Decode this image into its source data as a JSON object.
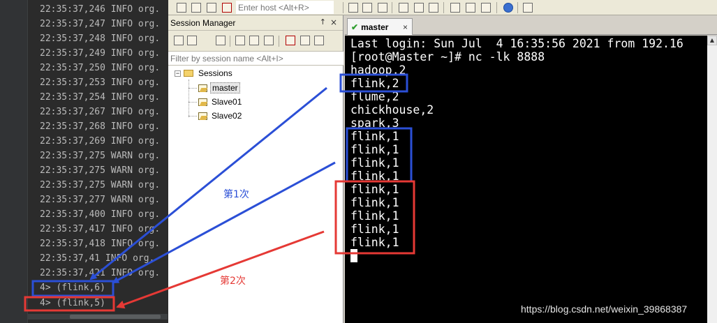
{
  "log_console": {
    "lines": [
      {
        "time": "22:35:37,246",
        "level": "INFO",
        "source": "org."
      },
      {
        "time": "22:35:37,247",
        "level": "INFO",
        "source": "org."
      },
      {
        "time": "22:35:37,248",
        "level": "INFO",
        "source": "org."
      },
      {
        "time": "22:35:37,249",
        "level": "INFO",
        "source": "org."
      },
      {
        "time": "22:35:37,250",
        "level": "INFO",
        "source": "org."
      },
      {
        "time": "22:35:37,253",
        "level": "INFO",
        "source": "org."
      },
      {
        "time": "22:35:37,254",
        "level": "INFO",
        "source": "org."
      },
      {
        "time": "22:35:37,267",
        "level": "INFO",
        "source": "org."
      },
      {
        "time": "22:35:37,268",
        "level": "INFO",
        "source": "org."
      },
      {
        "time": "22:35:37,269",
        "level": "INFO",
        "source": "org."
      },
      {
        "time": "22:35:37,275",
        "level": "WARN",
        "source": "org."
      },
      {
        "time": "22:35:37,275",
        "level": "WARN",
        "source": "org."
      },
      {
        "time": "22:35:37,275",
        "level": "WARN",
        "source": "org."
      },
      {
        "time": "22:35:37,277",
        "level": "WARN",
        "source": "org."
      },
      {
        "time": "22:35:37,400",
        "level": "INFO",
        "source": "org."
      },
      {
        "time": "22:35:37,417",
        "level": "INFO",
        "source": "org."
      },
      {
        "time": "22:35:37,418",
        "level": "INFO",
        "source": "org."
      },
      {
        "time": "22:35:37,41",
        "level": "INFO",
        "source": "org."
      },
      {
        "time": "22:35:37,421",
        "level": "INFO",
        "source": "org."
      }
    ],
    "results": [
      "4> (flink,6)",
      "4> (flink,5)"
    ]
  },
  "toolbar": {
    "host_placeholder": "Enter host <Alt+R>"
  },
  "session_manager": {
    "title": "Session Manager",
    "pin": "↑",
    "close": "×",
    "filter_placeholder": "Filter by session name <Alt+I>",
    "root": "Sessions",
    "sessions": [
      "master",
      "Slave01",
      "Slave02"
    ],
    "selected": "master"
  },
  "tab": {
    "label": "master",
    "close": "×"
  },
  "terminal": {
    "lines": [
      "Last login: Sun Jul  4 16:35:56 2021 from 192.16",
      "[root@Master ~]# nc -lk 8888",
      "hadoop,2",
      "flink,2",
      "flume,2",
      "chickhouse,2",
      "spark,3",
      "flink,1",
      "flink,1",
      "flink,1",
      "flink,1",
      "flink,1",
      "flink,1",
      "flink,1",
      "flink,1",
      "flink,1"
    ]
  },
  "annotations": {
    "first_label": "第1次",
    "second_label": "第2次",
    "blue": "#2b4fd6",
    "red": "#e53935"
  },
  "watermark": "https://blog.csdn.net/weixin_39868387",
  "colors": {
    "log_bg": "#2b2b2b",
    "terminal_bg": "#000000",
    "chrome_bg": "#d4d0c8"
  }
}
